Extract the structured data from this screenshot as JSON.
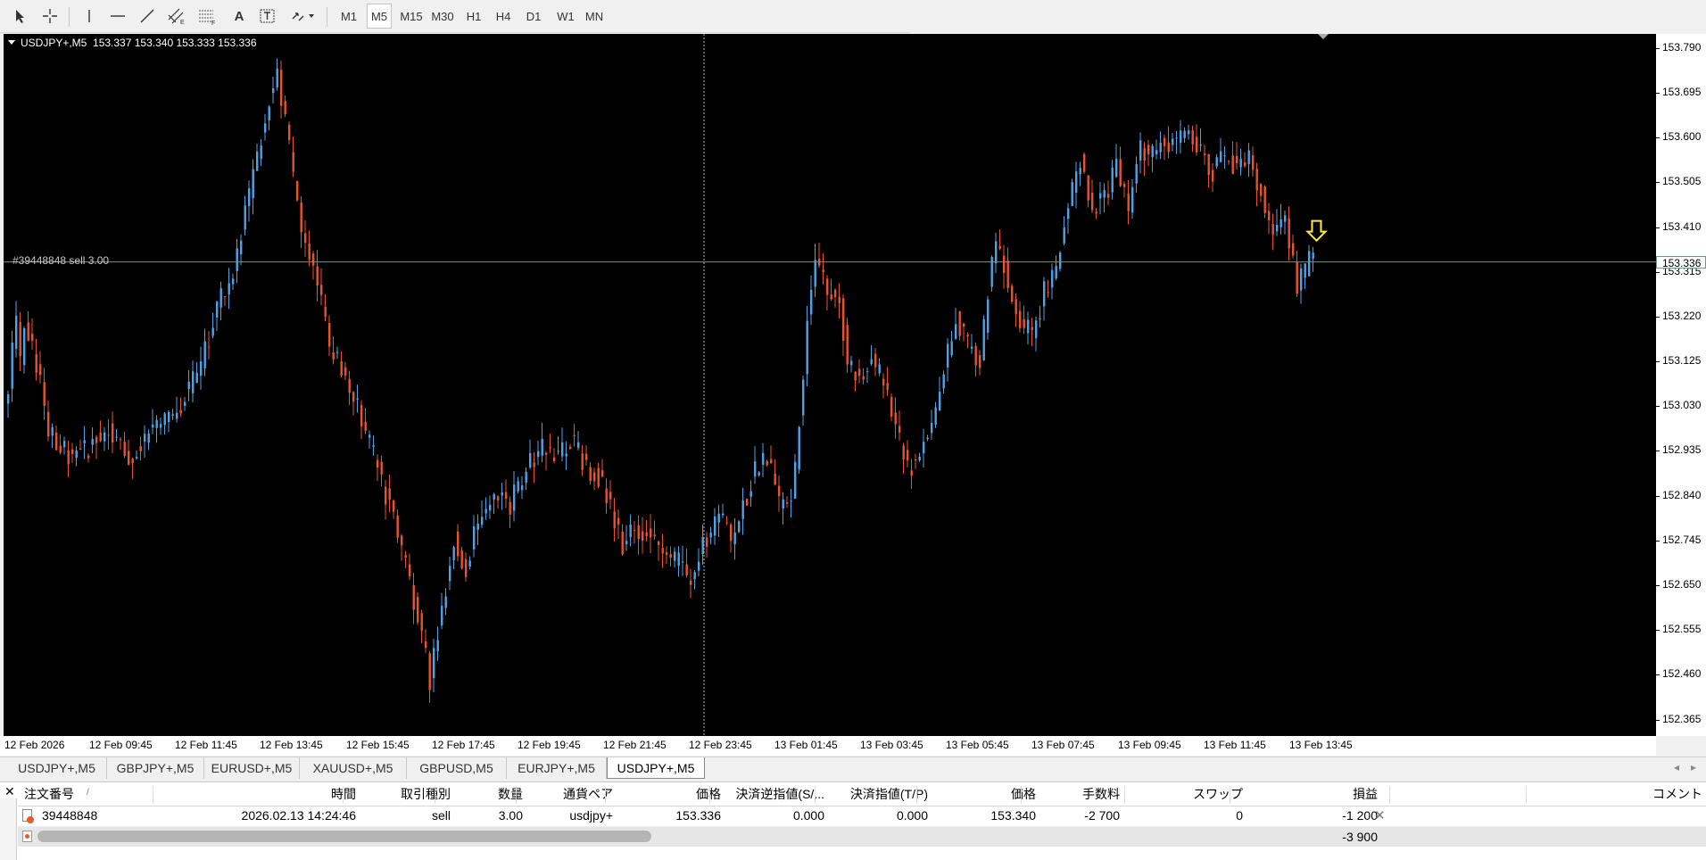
{
  "toolbar": {
    "timeframes": [
      {
        "label": "M1",
        "active": false
      },
      {
        "label": "M5",
        "active": true
      },
      {
        "label": "M15",
        "active": false
      },
      {
        "label": "M30",
        "active": false
      },
      {
        "label": "H1",
        "active": false
      },
      {
        "label": "H4",
        "active": false
      },
      {
        "label": "D1",
        "active": false
      },
      {
        "label": "W1",
        "active": false
      },
      {
        "label": "MN",
        "active": false
      }
    ],
    "text_tool_label": "A"
  },
  "chart": {
    "header": "USDJPY+,M5  153.337 153.340 153.333 153.336",
    "order_line_label": "#39448848 sell 3.00",
    "current_price_label": "153.336",
    "price_axis_labels": [
      "153.790",
      "153.695",
      "153.600",
      "153.505",
      "153.410",
      "153.315",
      "153.220",
      "153.125",
      "153.030",
      "152.935",
      "152.840",
      "152.745",
      "152.650",
      "152.555",
      "152.460",
      "152.365"
    ],
    "time_axis_labels": [
      "12 Feb 2026",
      "12 Feb 09:45",
      "12 Feb 11:45",
      "12 Feb 13:45",
      "12 Feb 15:45",
      "12 Feb 17:45",
      "12 Feb 19:45",
      "12 Feb 21:45",
      "12 Feb 23:45",
      "13 Feb 01:45",
      "13 Feb 03:45",
      "13 Feb 05:45",
      "13 Feb 07:45",
      "13 Feb 09:45",
      "13 Feb 11:45",
      "13 Feb 13:45"
    ],
    "colors": {
      "background": "#000000",
      "bull": "#4ea3e6",
      "bear": "#e8552a",
      "order_line": "#6f9a7a",
      "arrow": "#ffeb3b"
    }
  },
  "chart_data": {
    "type": "candlestick",
    "symbol": "USDJPY+",
    "timeframe": "M5",
    "ylim": [
      152.33,
      153.82
    ],
    "price_anchors": [
      [
        0,
        153.08
      ],
      [
        2,
        153.22
      ],
      [
        3,
        153.12
      ],
      [
        4,
        153.22
      ],
      [
        7,
        153.12
      ],
      [
        10,
        152.98
      ],
      [
        15,
        152.93
      ],
      [
        20,
        152.94
      ],
      [
        25,
        152.99
      ],
      [
        30,
        152.92
      ],
      [
        36,
        152.99
      ],
      [
        42,
        153.02
      ],
      [
        48,
        153.12
      ],
      [
        52,
        153.24
      ],
      [
        56,
        153.32
      ],
      [
        60,
        153.48
      ],
      [
        64,
        153.65
      ],
      [
        67,
        153.74
      ],
      [
        70,
        153.58
      ],
      [
        73,
        153.39
      ],
      [
        77,
        153.29
      ],
      [
        80,
        153.15
      ],
      [
        84,
        153.09
      ],
      [
        88,
        153.0
      ],
      [
        92,
        152.9
      ],
      [
        96,
        152.79
      ],
      [
        100,
        152.66
      ],
      [
        103,
        152.54
      ],
      [
        105,
        152.45
      ],
      [
        108,
        152.6
      ],
      [
        111,
        152.75
      ],
      [
        114,
        152.68
      ],
      [
        117,
        152.79
      ],
      [
        121,
        152.85
      ],
      [
        125,
        152.82
      ],
      [
        129,
        152.9
      ],
      [
        133,
        152.94
      ],
      [
        137,
        152.92
      ],
      [
        140,
        152.96
      ],
      [
        144,
        152.9
      ],
      [
        147,
        152.88
      ],
      [
        150,
        152.82
      ],
      [
        153,
        152.74
      ],
      [
        157,
        152.77
      ],
      [
        160,
        152.75
      ],
      [
        163,
        152.71
      ],
      [
        167,
        152.7
      ],
      [
        170,
        152.66
      ],
      [
        173,
        152.74
      ],
      [
        177,
        152.8
      ],
      [
        180,
        152.75
      ],
      [
        183,
        152.82
      ],
      [
        186,
        152.89
      ],
      [
        189,
        152.92
      ],
      [
        192,
        152.82
      ],
      [
        195,
        152.82
      ],
      [
        197,
        153.0
      ],
      [
        199,
        153.22
      ],
      [
        201,
        153.33
      ],
      [
        204,
        153.28
      ],
      [
        207,
        153.25
      ],
      [
        209,
        153.13
      ],
      [
        212,
        153.09
      ],
      [
        215,
        153.13
      ],
      [
        218,
        153.08
      ],
      [
        221,
        152.99
      ],
      [
        224,
        152.89
      ],
      [
        227,
        152.93
      ],
      [
        230,
        152.98
      ],
      [
        233,
        153.1
      ],
      [
        236,
        153.22
      ],
      [
        239,
        153.16
      ],
      [
        242,
        153.12
      ],
      [
        244,
        153.27
      ],
      [
        246,
        153.38
      ],
      [
        249,
        153.3
      ],
      [
        252,
        153.21
      ],
      [
        255,
        153.18
      ],
      [
        258,
        153.27
      ],
      [
        261,
        153.33
      ],
      [
        264,
        153.46
      ],
      [
        267,
        153.56
      ],
      [
        270,
        153.45
      ],
      [
        273,
        153.47
      ],
      [
        276,
        153.54
      ],
      [
        279,
        153.45
      ],
      [
        282,
        153.58
      ],
      [
        285,
        153.56
      ],
      [
        288,
        153.6
      ],
      [
        291,
        153.58
      ],
      [
        294,
        153.62
      ],
      [
        297,
        153.57
      ],
      [
        300,
        153.53
      ],
      [
        303,
        153.56
      ],
      [
        306,
        153.54
      ],
      [
        309,
        153.55
      ],
      [
        312,
        153.49
      ],
      [
        315,
        153.39
      ],
      [
        318,
        153.42
      ],
      [
        321,
        153.28
      ],
      [
        323,
        153.32
      ],
      [
        325,
        153.36
      ]
    ],
    "order_line_price": 153.336,
    "current_price": 153.336
  },
  "tabs": [
    "USDJPY+,M5",
    "GBPJPY+,M5",
    "EURUSD+,M5",
    "XAUUSD+,M5",
    "GBPUSD,M5",
    "EURJPY+,M5",
    "USDJPY+,M5"
  ],
  "active_tab": 6,
  "terminal": {
    "headers": [
      "注文番号",
      "時間",
      "取引種別",
      "数量",
      "通貨ペア",
      "価格",
      "決済逆指値(S/...",
      "決済指値(T/P)",
      "価格",
      "手数料",
      "スワップ",
      "損益",
      "コメント"
    ],
    "sort_marker": "/",
    "order": {
      "ticket": "39448848",
      "time": "2026.02.13 14:24:46",
      "type": "sell",
      "volume": "3.00",
      "symbol": "usdjpy+",
      "open_price": "153.336",
      "sl": "0.000",
      "tp": "0.000",
      "price": "153.340",
      "commission": "-2 700",
      "swap": "0",
      "profit": "-1 200"
    },
    "total_profit": "-3 900"
  }
}
